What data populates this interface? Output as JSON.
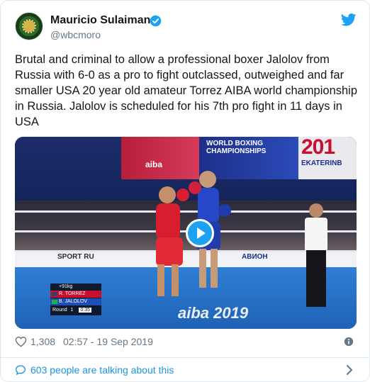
{
  "user": {
    "display_name": "Mauricio Sulaiman",
    "handle": "@wbcmoro",
    "verified": true
  },
  "tweet": {
    "text": "Brutal and criminal to allow a professional boxer Jalolov from Russia with 6-0 as a pro to fight outclassed, outweighed and far smaller USA 20 year old amateur Torrez AIBA world championship in Russia. Jalolov is scheduled for his 7th pro fight in 11 days in USA"
  },
  "media": {
    "type": "video",
    "banner_line1": "WORLD BOXING",
    "banner_line2": "CHAMPIONSHIPS",
    "year_partial": "201",
    "city_partial": "EKATERINB",
    "aiba_side": "aiba",
    "ad_left": "SPORT RU",
    "ad_right": "АВИОН",
    "floor_text": "aiba 2019",
    "scoreboard": {
      "weight": "+91kg",
      "fighter_red": "R. TORREZ",
      "fighter_blue": "B. JALOLOV",
      "round_label": "Round",
      "round_number": "1",
      "clock": "0:35"
    }
  },
  "stats": {
    "likes": "1,308",
    "timestamp": "02:57 - 19 Sep 2019"
  },
  "conversation": {
    "label": "603 people are talking about this"
  },
  "colors": {
    "twitter_blue": "#1da1f2",
    "link_blue": "#1b95e0",
    "secondary_text": "#657786",
    "border": "#e1e8ed"
  },
  "icons": [
    "verified-icon",
    "twitter-bird-icon",
    "play-icon",
    "heart-icon",
    "info-icon",
    "speech-bubble-icon",
    "chevron-right-icon"
  ]
}
